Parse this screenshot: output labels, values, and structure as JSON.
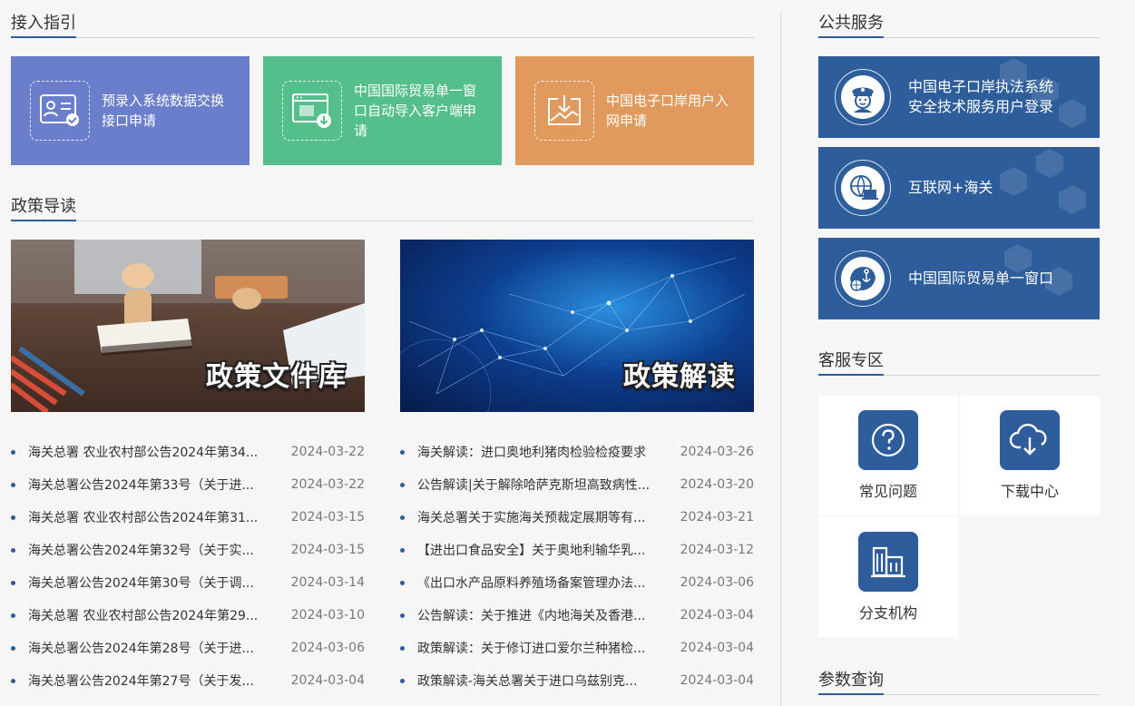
{
  "access": {
    "title": "接入指引",
    "cards": [
      {
        "label": "预录入系统数据交换接口申请",
        "icon": "id-card-check-icon",
        "color": "#6b7ecb"
      },
      {
        "label": "中国国际贸易单一窗口自动导入客户端申请",
        "icon": "window-download-icon",
        "color": "#55bf8b"
      },
      {
        "label": "中国电子口岸用户入网申请",
        "icon": "tray-download-icon",
        "color": "#e09a5d"
      }
    ]
  },
  "policy": {
    "title": "政策导读",
    "banners": [
      {
        "caption": "政策文件库"
      },
      {
        "caption": "政策解读"
      }
    ],
    "left_items": [
      {
        "title": "海关总署 农业农村部公告2024年第34...",
        "date": "2024-03-22"
      },
      {
        "title": "海关总署公告2024年第33号（关于进...",
        "date": "2024-03-22"
      },
      {
        "title": "海关总署 农业农村部公告2024年第31...",
        "date": "2024-03-15"
      },
      {
        "title": "海关总署公告2024年第32号（关于实...",
        "date": "2024-03-15"
      },
      {
        "title": "海关总署公告2024年第30号（关于调...",
        "date": "2024-03-14"
      },
      {
        "title": "海关总署 农业农村部公告2024年第29...",
        "date": "2024-03-10"
      },
      {
        "title": "海关总署公告2024年第28号（关于进...",
        "date": "2024-03-06"
      },
      {
        "title": "海关总署公告2024年第27号（关于发...",
        "date": "2024-03-04"
      }
    ],
    "right_items": [
      {
        "title": "海关解读：进口奥地利猪肉检验检疫要求",
        "date": "2024-03-26"
      },
      {
        "title": "公告解读|关于解除哈萨克斯坦高致病性...",
        "date": "2024-03-20"
      },
      {
        "title": "海关总署关于实施海关预裁定展期等有...",
        "date": "2024-03-21"
      },
      {
        "title": "【进出口食品安全】关于奥地利输华乳...",
        "date": "2024-03-12"
      },
      {
        "title": "《出口水产品原料养殖场备案管理办法...",
        "date": "2024-03-06"
      },
      {
        "title": "公告解读：关于推进《内地海关及香港...",
        "date": "2024-03-04"
      },
      {
        "title": "政策解读：关于修订进口爱尔兰种猪检...",
        "date": "2024-03-04"
      },
      {
        "title": "政策解读-海关总署关于进口乌兹别克...",
        "date": "2024-03-04"
      }
    ]
  },
  "public_services": {
    "title": "公共服务",
    "items": [
      {
        "label_line1": "中国电子口岸执法系统",
        "label_line2": "安全技术服务用户登录",
        "icon": "police-officer-icon"
      },
      {
        "label_line1": "互联网+海关",
        "label_line2": "",
        "icon": "globe-laptop-icon"
      },
      {
        "label_line1": "中国国际贸易单一窗口",
        "label_line2": "",
        "icon": "globe-anchor-icon"
      }
    ]
  },
  "customer_service": {
    "title": "客服专区",
    "tiles": [
      {
        "label": "常见问题",
        "icon": "question-circle-icon"
      },
      {
        "label": "下载中心",
        "icon": "cloud-download-icon"
      },
      {
        "label": "分支机构",
        "icon": "buildings-icon"
      }
    ]
  },
  "params": {
    "title": "参数查询"
  },
  "colors": {
    "brand": "#2d5d9a",
    "card1": "#6b7ecb",
    "card2": "#55bf8b",
    "card3": "#e09a5d"
  }
}
